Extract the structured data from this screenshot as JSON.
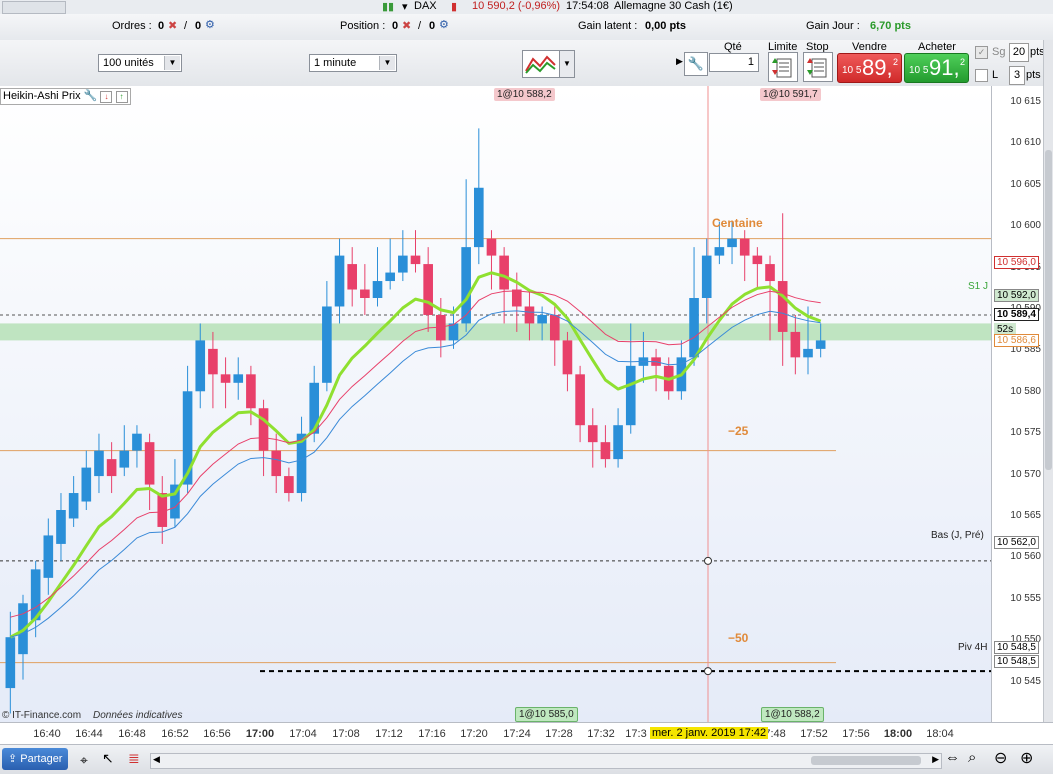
{
  "top": {
    "instrument": "DAX",
    "price": "10 590,2 (-0,96%)",
    "time": "17:54:08",
    "market": "Allemagne 30 Cash (1€)"
  },
  "orders_bar": {
    "orders_label": "Ordres :",
    "orders_count": "0",
    "orders_count2": "0",
    "position_label": "Position :",
    "position_count": "0",
    "position_count2": "0",
    "gain_latent_label": "Gain latent :",
    "gain_latent_value": "0,00 pts",
    "gain_jour_label": "Gain Jour :",
    "gain_jour_value": "6,70 pts"
  },
  "controls": {
    "units": "100 unités",
    "interval": "1 minute",
    "qty_label": "Qté",
    "qty_value": "1",
    "limite_label": "Limite",
    "stop_label": "Stop",
    "vendre_label": "Vendre",
    "vendre_prefix": "10 5",
    "vendre_big": "89,",
    "vendre_sup": "2",
    "acheter_label": "Acheter",
    "acheter_prefix": "10 5",
    "acheter_big": "91,",
    "acheter_sup": "2",
    "sg_label": "Sg",
    "sg_value": "20",
    "sg_unit": "pts",
    "l_label": "L",
    "l_value": "3",
    "l_unit": "pts"
  },
  "chart": {
    "indicator": "Heikin-Ashi Prix",
    "tags": {
      "top_left": "1@10 588,2",
      "top_right": "1@10 591,7",
      "bottom_left": "1@10 585,0",
      "bottom_right": "1@10 588,2"
    },
    "annotations": {
      "centaine": "Centaine",
      "m25": "−25",
      "m50": "−50",
      "s1": "S1 J",
      "bas": "Bas (J, Pré)",
      "piv": "Piv 4H"
    },
    "copyright": "© IT-Finance.com",
    "disclaimer": "Données indicatives",
    "crosshair_date": "mer. 2 janv. 2019 17:42"
  },
  "yaxis": {
    "labels": [
      "10 615",
      "10 610",
      "10 605",
      "10 600",
      "10 595",
      "10 590",
      "10 585",
      "10 580",
      "10 575",
      "10 570",
      "10 565",
      "10 560",
      "10 555",
      "10 550",
      "10 545"
    ],
    "boxes": {
      "b1": "10 596,0",
      "b2": "10 592,0",
      "current": "10 589,4",
      "countdown": "52s",
      "b3": "10 586,6",
      "b4": "10 562,0",
      "b5": "10 548,5",
      "b6": "10 548,5"
    }
  },
  "xaxis": {
    "labels": [
      "16:40",
      "16:44",
      "16:48",
      "16:52",
      "16:56",
      "17:00",
      "17:04",
      "17:08",
      "17:12",
      "17:16",
      "17:20",
      "17:24",
      "17:28",
      "17:32",
      "17:3",
      "17:48",
      "17:52",
      "17:56",
      "18:00",
      "18:04"
    ]
  },
  "bottom": {
    "share": "Partager"
  },
  "chart_data": {
    "type": "candlestick",
    "title": "DAX Heikin-Ashi Prix — 1 minute",
    "ylim": [
      10543,
      10618
    ],
    "levels": {
      "centaine": 10600,
      "s1": 10591,
      "bas": 10562,
      "piv": 10549,
      "m25": 10575,
      "m50": 10550,
      "band": [
        10588,
        10590
      ]
    },
    "candles": [
      {
        "o": 10547,
        "c": 10553,
        "h": 10556,
        "l": 10544
      },
      {
        "o": 10551,
        "c": 10557,
        "h": 10558,
        "l": 10548
      },
      {
        "o": 10555,
        "c": 10561,
        "h": 10562,
        "l": 10553
      },
      {
        "o": 10560,
        "c": 10565,
        "h": 10567,
        "l": 10558
      },
      {
        "o": 10564,
        "c": 10568,
        "h": 10570,
        "l": 10562
      },
      {
        "o": 10567,
        "c": 10570,
        "h": 10572,
        "l": 10566
      },
      {
        "o": 10569,
        "c": 10573,
        "h": 10575,
        "l": 10568
      },
      {
        "o": 10572,
        "c": 10575,
        "h": 10577,
        "l": 10570
      },
      {
        "o": 10574,
        "c": 10572,
        "h": 10576,
        "l": 10570
      },
      {
        "o": 10573,
        "c": 10575,
        "h": 10578,
        "l": 10572
      },
      {
        "o": 10575,
        "c": 10577,
        "h": 10578,
        "l": 10573
      },
      {
        "o": 10576,
        "c": 10571,
        "h": 10577,
        "l": 10568
      },
      {
        "o": 10570,
        "c": 10566,
        "h": 10572,
        "l": 10564
      },
      {
        "o": 10567,
        "c": 10571,
        "h": 10574,
        "l": 10566
      },
      {
        "o": 10571,
        "c": 10582,
        "h": 10585,
        "l": 10570
      },
      {
        "o": 10582,
        "c": 10588,
        "h": 10590,
        "l": 10580
      },
      {
        "o": 10587,
        "c": 10584,
        "h": 10589,
        "l": 10580
      },
      {
        "o": 10584,
        "c": 10583,
        "h": 10586,
        "l": 10580
      },
      {
        "o": 10583,
        "c": 10584,
        "h": 10586,
        "l": 10581
      },
      {
        "o": 10584,
        "c": 10580,
        "h": 10585,
        "l": 10578
      },
      {
        "o": 10580,
        "c": 10575,
        "h": 10581,
        "l": 10572
      },
      {
        "o": 10575,
        "c": 10572,
        "h": 10577,
        "l": 10570
      },
      {
        "o": 10572,
        "c": 10570,
        "h": 10573,
        "l": 10569
      },
      {
        "o": 10570,
        "c": 10577,
        "h": 10579,
        "l": 10569
      },
      {
        "o": 10577,
        "c": 10583,
        "h": 10585,
        "l": 10576
      },
      {
        "o": 10583,
        "c": 10592,
        "h": 10595,
        "l": 10582
      },
      {
        "o": 10592,
        "c": 10598,
        "h": 10600,
        "l": 10590
      },
      {
        "o": 10597,
        "c": 10594,
        "h": 10599,
        "l": 10592
      },
      {
        "o": 10594,
        "c": 10593,
        "h": 10597,
        "l": 10591
      },
      {
        "o": 10593,
        "c": 10595,
        "h": 10599,
        "l": 10592
      },
      {
        "o": 10595,
        "c": 10596,
        "h": 10600,
        "l": 10594
      },
      {
        "o": 10596,
        "c": 10598,
        "h": 10601,
        "l": 10595
      },
      {
        "o": 10598,
        "c": 10597,
        "h": 10601,
        "l": 10596
      },
      {
        "o": 10597,
        "c": 10591,
        "h": 10599,
        "l": 10589
      },
      {
        "o": 10591,
        "c": 10588,
        "h": 10593,
        "l": 10586
      },
      {
        "o": 10588,
        "c": 10590,
        "h": 10592,
        "l": 10587
      },
      {
        "o": 10590,
        "c": 10599,
        "h": 10607,
        "l": 10589
      },
      {
        "o": 10599,
        "c": 10606,
        "h": 10613,
        "l": 10597
      },
      {
        "o": 10600,
        "c": 10598,
        "h": 10601,
        "l": 10594
      },
      {
        "o": 10598,
        "c": 10594,
        "h": 10599,
        "l": 10590
      },
      {
        "o": 10594,
        "c": 10592,
        "h": 10596,
        "l": 10589
      },
      {
        "o": 10592,
        "c": 10590,
        "h": 10594,
        "l": 10588
      },
      {
        "o": 10590,
        "c": 10591,
        "h": 10592,
        "l": 10588
      },
      {
        "o": 10591,
        "c": 10588,
        "h": 10592,
        "l": 10585
      },
      {
        "o": 10588,
        "c": 10584,
        "h": 10589,
        "l": 10582
      },
      {
        "o": 10584,
        "c": 10578,
        "h": 10585,
        "l": 10576
      },
      {
        "o": 10578,
        "c": 10576,
        "h": 10580,
        "l": 10573
      },
      {
        "o": 10576,
        "c": 10574,
        "h": 10578,
        "l": 10573
      },
      {
        "o": 10574,
        "c": 10578,
        "h": 10580,
        "l": 10573
      },
      {
        "o": 10578,
        "c": 10585,
        "h": 10590,
        "l": 10577
      },
      {
        "o": 10585,
        "c": 10586,
        "h": 10589,
        "l": 10583
      },
      {
        "o": 10586,
        "c": 10585,
        "h": 10587,
        "l": 10582
      },
      {
        "o": 10585,
        "c": 10582,
        "h": 10586,
        "l": 10581
      },
      {
        "o": 10582,
        "c": 10586,
        "h": 10588,
        "l": 10581
      },
      {
        "o": 10586,
        "c": 10593,
        "h": 10599,
        "l": 10585
      },
      {
        "o": 10593,
        "c": 10598,
        "h": 10600,
        "l": 10590
      },
      {
        "o": 10598,
        "c": 10599,
        "h": 10602,
        "l": 10597
      },
      {
        "o": 10599,
        "c": 10600,
        "h": 10602,
        "l": 10597
      },
      {
        "o": 10600,
        "c": 10598,
        "h": 10601,
        "l": 10595
      },
      {
        "o": 10598,
        "c": 10597,
        "h": 10599,
        "l": 10594
      },
      {
        "o": 10597,
        "c": 10595,
        "h": 10598,
        "l": 10588
      },
      {
        "o": 10595,
        "c": 10589,
        "h": 10603,
        "l": 10585
      },
      {
        "o": 10589,
        "c": 10586,
        "h": 10591,
        "l": 10584
      },
      {
        "o": 10586,
        "c": 10587,
        "h": 10592,
        "l": 10584
      },
      {
        "o": 10587,
        "c": 10588,
        "h": 10590,
        "l": 10586
      }
    ]
  }
}
